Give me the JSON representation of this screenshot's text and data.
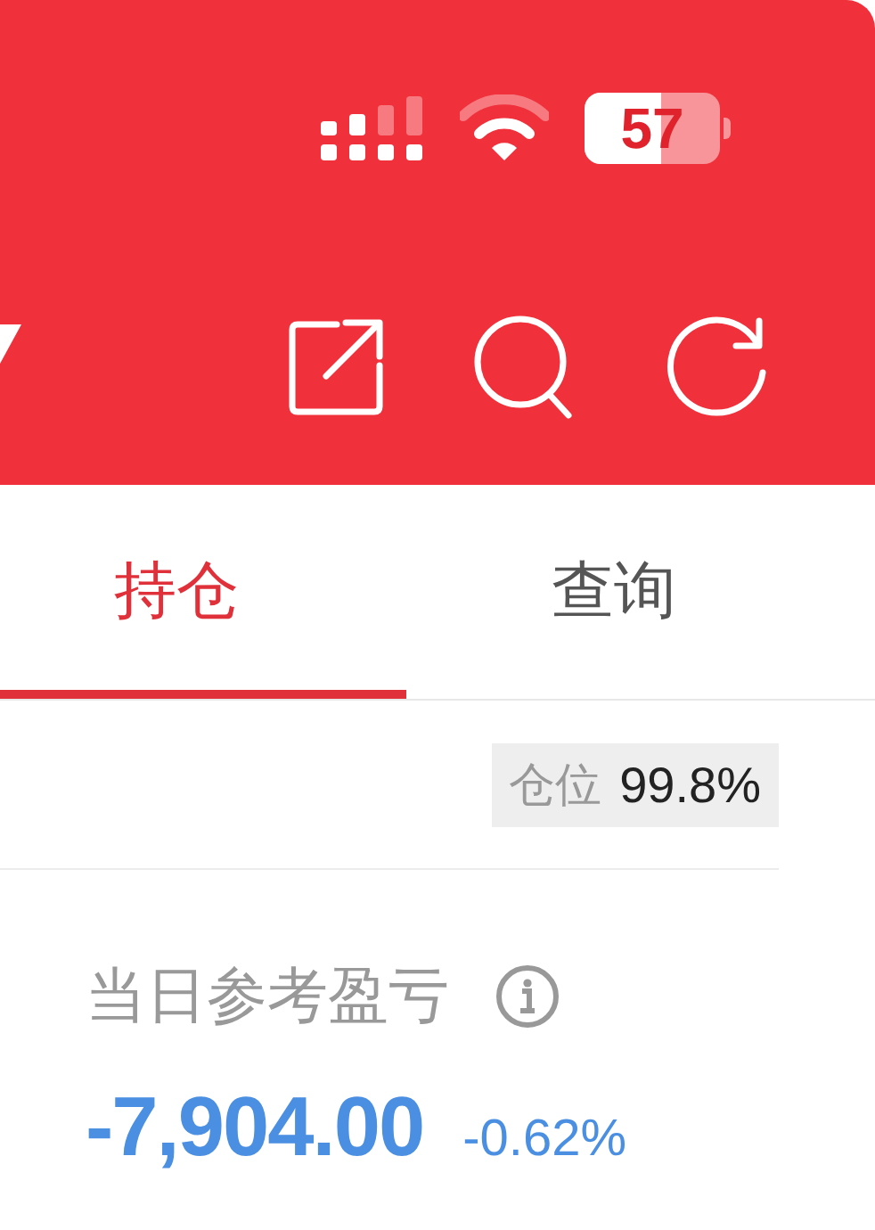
{
  "status_bar": {
    "battery": "57"
  },
  "tabs": [
    {
      "label": "持仓",
      "selected": true
    },
    {
      "label": "查询",
      "selected": false
    }
  ],
  "position_badge": {
    "label": "仓位",
    "value": "99.8%"
  },
  "daily_pnl": {
    "label": "当日参考盈亏",
    "value": "-7,904.00",
    "percent": "-0.62%"
  }
}
